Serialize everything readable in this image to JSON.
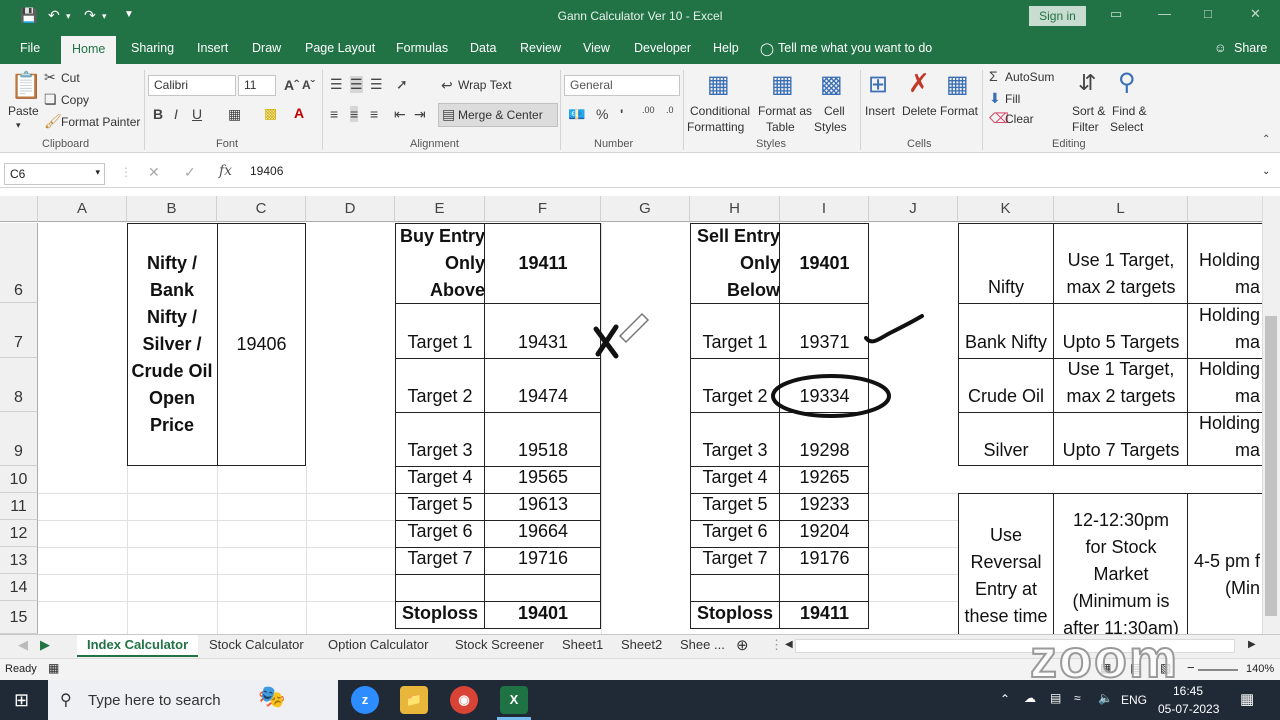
{
  "window": {
    "title": "Gann Calculator Ver 10  -  Excel",
    "sign_in": "Sign in"
  },
  "menu": {
    "tabs": [
      "File",
      "Home",
      "Sharing",
      "Insert",
      "Draw",
      "Page Layout",
      "Formulas",
      "Data",
      "Review",
      "View",
      "Developer",
      "Help"
    ],
    "active": "Home",
    "tell_me": "Tell me what you want to do",
    "share": "Share"
  },
  "ribbon": {
    "clipboard": {
      "paste": "Paste",
      "cut": "Cut",
      "copy": "Copy",
      "format_painter": "Format Painter",
      "label": "Clipboard"
    },
    "font": {
      "name": "Calibri",
      "size": "11",
      "label": "Font"
    },
    "alignment": {
      "wrap": "Wrap Text",
      "merge": "Merge & Center",
      "label": "Alignment"
    },
    "number": {
      "format": "General",
      "label": "Number"
    },
    "styles": {
      "conditional": "Conditional",
      "conditional2": "Formatting",
      "format_as": "Format as",
      "table": "Table",
      "cell": "Cell",
      "styles_btn": "Styles",
      "label": "Styles"
    },
    "cells": {
      "insert": "Insert",
      "delete": "Delete",
      "format": "Format",
      "label": "Cells"
    },
    "editing": {
      "autosum": "AutoSum",
      "fill": "Fill",
      "clear": "Clear",
      "sort": "Sort &",
      "filter": "Filter",
      "find": "Find &",
      "select": "Select",
      "label": "Editing"
    }
  },
  "formula_bar": {
    "name_box": "C6",
    "formula": "19406"
  },
  "columns": [
    "A",
    "B",
    "C",
    "D",
    "E",
    "F",
    "G",
    "H",
    "I",
    "J",
    "K",
    "L"
  ],
  "rows": [
    "6",
    "7",
    "8",
    "9",
    "10",
    "11",
    "12",
    "13",
    "14",
    "15"
  ],
  "cells": {
    "b_merged": [
      "Nifty /",
      "Bank",
      "Nifty /",
      "Silver /",
      "Crude Oil",
      "Open",
      "Price"
    ],
    "c_merged": "19406",
    "buy_label": [
      "Buy Entry",
      "Only",
      "Above"
    ],
    "buy_value": "19411",
    "sell_label": [
      "Sell Entry",
      "Only",
      "Below"
    ],
    "sell_value": "19401",
    "buy_targets": [
      {
        "label": "Target 1",
        "value": "19431"
      },
      {
        "label": "Target 2",
        "value": "19474"
      },
      {
        "label": "Target 3",
        "value": "19518"
      },
      {
        "label": "Target 4",
        "value": "19565"
      },
      {
        "label": "Target 5",
        "value": "19613"
      },
      {
        "label": "Target 6",
        "value": "19664"
      },
      {
        "label": "Target 7",
        "value": "19716"
      }
    ],
    "sell_targets": [
      {
        "label": "Target 1",
        "value": "19371"
      },
      {
        "label": "Target 2",
        "value": "19334"
      },
      {
        "label": "Target 3",
        "value": "19298"
      },
      {
        "label": "Target 4",
        "value": "19265"
      },
      {
        "label": "Target 5",
        "value": "19233"
      },
      {
        "label": "Target 6",
        "value": "19204"
      },
      {
        "label": "Target 7",
        "value": "19176"
      }
    ],
    "buy_stoploss": {
      "label": "Stoploss",
      "value": "19401"
    },
    "sell_stoploss": {
      "label": "Stoploss",
      "value": "19411"
    },
    "k_col": [
      "Nifty",
      "Bank Nifty",
      "Crude Oil",
      "Silver"
    ],
    "l_col": [
      [
        "Use 1 Target,",
        "max 2 targets"
      ],
      [
        "Upto 5 Targets"
      ],
      [
        "Use 1 Target,",
        "max 2 targets"
      ],
      [
        "Upto 7 Targets"
      ]
    ],
    "m_col": [
      [
        "Holding",
        "ma"
      ],
      [
        "Holding",
        "ma"
      ],
      [
        "Holding",
        "ma"
      ],
      [
        "Holding",
        "ma"
      ]
    ],
    "k_reversal": [
      "Use",
      "Reversal",
      "Entry at",
      "these time"
    ],
    "l_time": [
      "12-12:30pm",
      "for Stock",
      "Market",
      "(Minimum is",
      "after 11:30am)"
    ],
    "m_time": [
      "4-5 pm f",
      "(Min"
    ]
  },
  "sheets": [
    "Index Calculator",
    "Stock Calculator",
    "Option Calculator",
    "Stock Screener",
    "Sheet1",
    "Sheet2",
    "Shee ..."
  ],
  "status": {
    "ready": "Ready",
    "zoom": "140%"
  },
  "taskbar": {
    "search_placeholder": "Type here to search",
    "lang": "ENG",
    "time": "16:45",
    "date": "05-07-2023"
  },
  "watermark": "zoom"
}
